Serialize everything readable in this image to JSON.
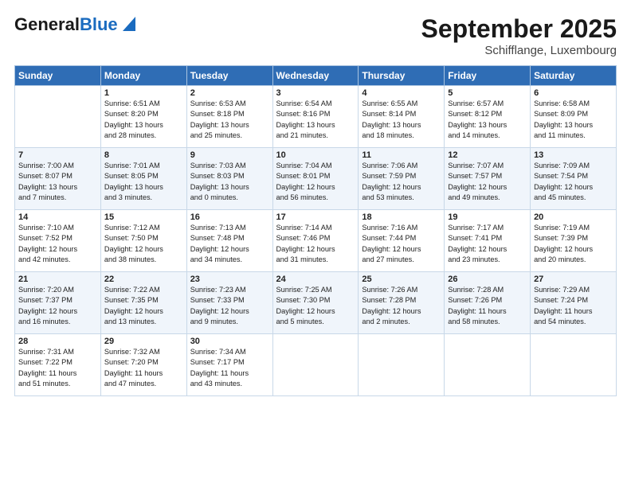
{
  "header": {
    "logo_general": "General",
    "logo_blue": "Blue",
    "month": "September 2025",
    "location": "Schifflange, Luxembourg"
  },
  "days_of_week": [
    "Sunday",
    "Monday",
    "Tuesday",
    "Wednesday",
    "Thursday",
    "Friday",
    "Saturday"
  ],
  "weeks": [
    [
      {
        "day": "",
        "content": ""
      },
      {
        "day": "1",
        "content": "Sunrise: 6:51 AM\nSunset: 8:20 PM\nDaylight: 13 hours\nand 28 minutes."
      },
      {
        "day": "2",
        "content": "Sunrise: 6:53 AM\nSunset: 8:18 PM\nDaylight: 13 hours\nand 25 minutes."
      },
      {
        "day": "3",
        "content": "Sunrise: 6:54 AM\nSunset: 8:16 PM\nDaylight: 13 hours\nand 21 minutes."
      },
      {
        "day": "4",
        "content": "Sunrise: 6:55 AM\nSunset: 8:14 PM\nDaylight: 13 hours\nand 18 minutes."
      },
      {
        "day": "5",
        "content": "Sunrise: 6:57 AM\nSunset: 8:12 PM\nDaylight: 13 hours\nand 14 minutes."
      },
      {
        "day": "6",
        "content": "Sunrise: 6:58 AM\nSunset: 8:09 PM\nDaylight: 13 hours\nand 11 minutes."
      }
    ],
    [
      {
        "day": "7",
        "content": "Sunrise: 7:00 AM\nSunset: 8:07 PM\nDaylight: 13 hours\nand 7 minutes."
      },
      {
        "day": "8",
        "content": "Sunrise: 7:01 AM\nSunset: 8:05 PM\nDaylight: 13 hours\nand 3 minutes."
      },
      {
        "day": "9",
        "content": "Sunrise: 7:03 AM\nSunset: 8:03 PM\nDaylight: 13 hours\nand 0 minutes."
      },
      {
        "day": "10",
        "content": "Sunrise: 7:04 AM\nSunset: 8:01 PM\nDaylight: 12 hours\nand 56 minutes."
      },
      {
        "day": "11",
        "content": "Sunrise: 7:06 AM\nSunset: 7:59 PM\nDaylight: 12 hours\nand 53 minutes."
      },
      {
        "day": "12",
        "content": "Sunrise: 7:07 AM\nSunset: 7:57 PM\nDaylight: 12 hours\nand 49 minutes."
      },
      {
        "day": "13",
        "content": "Sunrise: 7:09 AM\nSunset: 7:54 PM\nDaylight: 12 hours\nand 45 minutes."
      }
    ],
    [
      {
        "day": "14",
        "content": "Sunrise: 7:10 AM\nSunset: 7:52 PM\nDaylight: 12 hours\nand 42 minutes."
      },
      {
        "day": "15",
        "content": "Sunrise: 7:12 AM\nSunset: 7:50 PM\nDaylight: 12 hours\nand 38 minutes."
      },
      {
        "day": "16",
        "content": "Sunrise: 7:13 AM\nSunset: 7:48 PM\nDaylight: 12 hours\nand 34 minutes."
      },
      {
        "day": "17",
        "content": "Sunrise: 7:14 AM\nSunset: 7:46 PM\nDaylight: 12 hours\nand 31 minutes."
      },
      {
        "day": "18",
        "content": "Sunrise: 7:16 AM\nSunset: 7:44 PM\nDaylight: 12 hours\nand 27 minutes."
      },
      {
        "day": "19",
        "content": "Sunrise: 7:17 AM\nSunset: 7:41 PM\nDaylight: 12 hours\nand 23 minutes."
      },
      {
        "day": "20",
        "content": "Sunrise: 7:19 AM\nSunset: 7:39 PM\nDaylight: 12 hours\nand 20 minutes."
      }
    ],
    [
      {
        "day": "21",
        "content": "Sunrise: 7:20 AM\nSunset: 7:37 PM\nDaylight: 12 hours\nand 16 minutes."
      },
      {
        "day": "22",
        "content": "Sunrise: 7:22 AM\nSunset: 7:35 PM\nDaylight: 12 hours\nand 13 minutes."
      },
      {
        "day": "23",
        "content": "Sunrise: 7:23 AM\nSunset: 7:33 PM\nDaylight: 12 hours\nand 9 minutes."
      },
      {
        "day": "24",
        "content": "Sunrise: 7:25 AM\nSunset: 7:30 PM\nDaylight: 12 hours\nand 5 minutes."
      },
      {
        "day": "25",
        "content": "Sunrise: 7:26 AM\nSunset: 7:28 PM\nDaylight: 12 hours\nand 2 minutes."
      },
      {
        "day": "26",
        "content": "Sunrise: 7:28 AM\nSunset: 7:26 PM\nDaylight: 11 hours\nand 58 minutes."
      },
      {
        "day": "27",
        "content": "Sunrise: 7:29 AM\nSunset: 7:24 PM\nDaylight: 11 hours\nand 54 minutes."
      }
    ],
    [
      {
        "day": "28",
        "content": "Sunrise: 7:31 AM\nSunset: 7:22 PM\nDaylight: 11 hours\nand 51 minutes."
      },
      {
        "day": "29",
        "content": "Sunrise: 7:32 AM\nSunset: 7:20 PM\nDaylight: 11 hours\nand 47 minutes."
      },
      {
        "day": "30",
        "content": "Sunrise: 7:34 AM\nSunset: 7:17 PM\nDaylight: 11 hours\nand 43 minutes."
      },
      {
        "day": "",
        "content": ""
      },
      {
        "day": "",
        "content": ""
      },
      {
        "day": "",
        "content": ""
      },
      {
        "day": "",
        "content": ""
      }
    ]
  ]
}
